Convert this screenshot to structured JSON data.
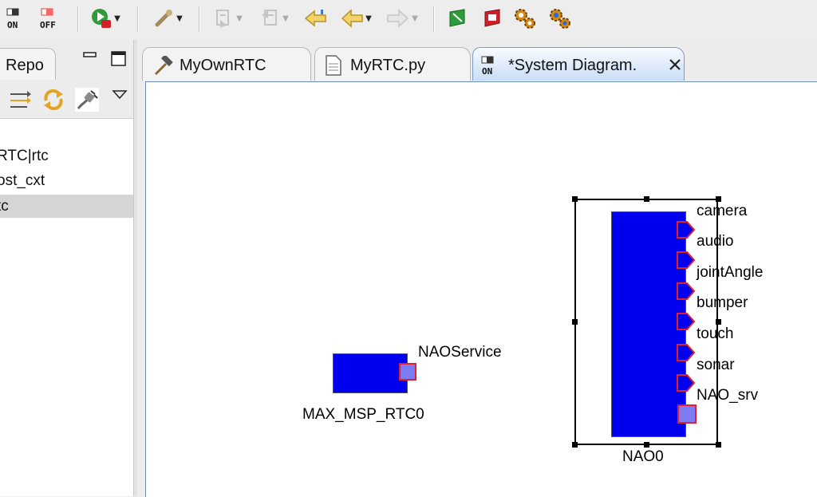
{
  "toolbar": {
    "on_label": "ON",
    "off_label": "OFF",
    "accent_green": "#2e9b3a",
    "accent_red": "#d2202a"
  },
  "left_view": {
    "tab_label": "Repo",
    "items": [
      "RTC|rtc",
      "ost_cxt",
      "tc"
    ],
    "selected_index": 2
  },
  "editor": {
    "tabs": [
      {
        "label": "MyOwnRTC",
        "icon": "hammer-icon"
      },
      {
        "label": "MyRTC.py",
        "icon": "file-icon"
      },
      {
        "label": "*System Diagram.",
        "icon": "system-diagram-icon",
        "active": true
      }
    ]
  },
  "diagram": {
    "component_fill": "#0000ee",
    "port_border": "#e0202a",
    "service_port_fill": "#7d7cf5",
    "components": [
      {
        "name": "MAX_MSP_RTC0",
        "service_ports": [
          "NAOService"
        ],
        "out_ports": []
      },
      {
        "name": "NAO0",
        "out_ports": [
          "camera",
          "audio",
          "jointAngle",
          "bumper",
          "touch",
          "sonar"
        ],
        "service_ports": [
          "NAO_srv"
        ],
        "selected": true
      }
    ]
  }
}
